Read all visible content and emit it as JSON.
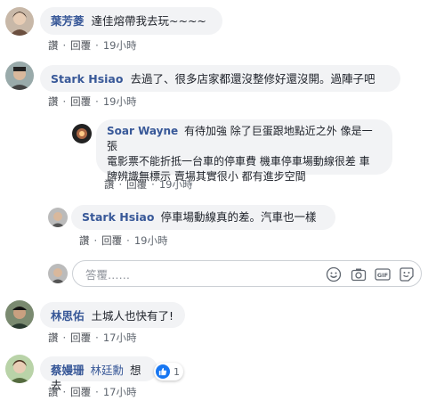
{
  "actions": {
    "like": "讚",
    "reply": "回覆",
    "separator": "·"
  },
  "comments": [
    {
      "name": "葉芳菱",
      "text": "達佳熔帶我去玩~~~~",
      "time": "19小時"
    },
    {
      "name": "Stark Hsiao",
      "text": "去過了、很多店家都還沒整修好還沒開。過陣子吧",
      "time": "19小時",
      "replies": [
        {
          "name": "Soar Wayne",
          "text_lines": [
            "有待加強 除了巨蛋跟地點近之外 像是一張",
            "電影票不能折抵一台車的停車費 機車停車場動線很差 車",
            "牌辨識無標示 賣場其實很小 都有進步空間"
          ],
          "time": "19小時"
        },
        {
          "name": "Stark Hsiao",
          "text": "停車場動線真的差。汽車也一樣",
          "time": "19小時"
        }
      ]
    },
    {
      "name": "林思佑",
      "text": "土城人也快有了!",
      "time": "17小時"
    },
    {
      "name": "蔡嫚珊",
      "tag": "林廷勳",
      "text": "想去",
      "time": "17小時",
      "reactions": {
        "count": "1",
        "type": "like"
      }
    }
  ],
  "reply_box": {
    "placeholder": "答覆……"
  },
  "icons": [
    "emoji-icon",
    "camera-icon",
    "gif-icon",
    "sticker-icon",
    "like-icon"
  ],
  "colors": {
    "name": "#385898",
    "bubble": "#f2f3f5",
    "like_blue": "#1877f2"
  }
}
